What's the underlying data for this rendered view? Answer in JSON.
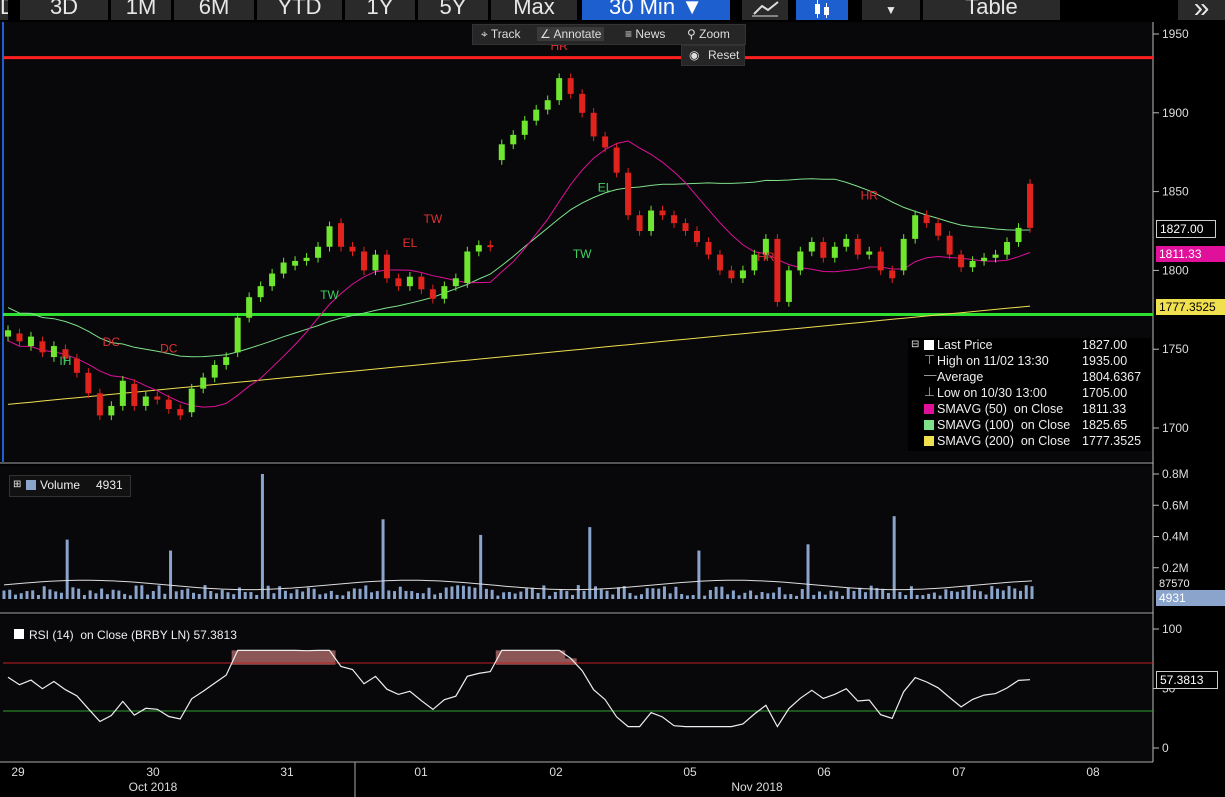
{
  "topbar": {
    "ranges": [
      "D",
      "3D",
      "1M",
      "6M",
      "YTD",
      "1Y",
      "5Y",
      "Max"
    ],
    "interval": "30 Min",
    "table_label": "Table",
    "more_glyph": "»"
  },
  "toolbar": {
    "track": "Track",
    "annotate": "Annotate",
    "news": "News",
    "zoom": "Zoom",
    "reset": "Reset"
  },
  "price_axis": {
    "ticks": [
      "1950",
      "1900",
      "1850",
      "1800",
      "1750",
      "1700"
    ]
  },
  "price_tags": {
    "last": "1827.00",
    "sma50": "1811.33",
    "sma200": "1777.3525"
  },
  "colors": {
    "up": "#6fe62f",
    "down": "#e0231c",
    "sma50": "#e0109a",
    "sma100": "#7fe08a",
    "sma200": "#f0e050",
    "hline_red": "#ff2020",
    "hline_green": "#30e030"
  },
  "annotations": [
    {
      "text": "HR",
      "color": "red"
    },
    {
      "text": "TW",
      "color": "red"
    },
    {
      "text": "EL",
      "color": "red"
    },
    {
      "text": "DC",
      "color": "red"
    },
    {
      "text": "DC",
      "color": "red"
    },
    {
      "text": "IH",
      "color": "green"
    },
    {
      "text": "TW",
      "color": "green"
    },
    {
      "text": "TW",
      "color": "green"
    },
    {
      "text": "EL",
      "color": "green"
    },
    {
      "text": "HR",
      "color": "red"
    },
    {
      "text": "HR",
      "color": "red"
    }
  ],
  "legend": {
    "rows": [
      {
        "name": "Last Price",
        "value": "1827.00"
      },
      {
        "name": "High on 11/02 13:30",
        "value": "1935.00"
      },
      {
        "name": "Average",
        "value": "1804.6367"
      },
      {
        "name": "Low on 10/30 13:00",
        "value": "1705.00"
      },
      {
        "name": "SMAVG (50)  on Close",
        "value": "1811.33"
      },
      {
        "name": "SMAVG (100)  on Close",
        "value": "1825.65"
      },
      {
        "name": "SMAVG (200)  on Close",
        "value": "1777.3525"
      }
    ]
  },
  "volume": {
    "label": "Volume",
    "value": "4931",
    "axis_ticks": [
      "0.8M",
      "0.6M",
      "0.4M",
      "0.2M"
    ],
    "avg_tag": "87570",
    "last_tag": "4931"
  },
  "rsi": {
    "label": "RSI (14)  on Close (BRBY LN) 57.3813",
    "axis_ticks": [
      "100",
      "50",
      "0"
    ],
    "tag": "57.3813"
  },
  "xaxis": {
    "days": [
      "29",
      "30",
      "31",
      "01",
      "02",
      "05",
      "06",
      "07",
      "08"
    ],
    "months": [
      "Oct 2018",
      "Nov 2018"
    ]
  },
  "chart_data": {
    "type": "candlestick",
    "ylim": [
      1690,
      1955
    ],
    "hlines": [
      1935,
      1772
    ],
    "candles": [
      [
        1758,
        1762
      ],
      [
        1760,
        1755
      ],
      [
        1752,
        1758
      ],
      [
        1755,
        1748
      ],
      [
        1745,
        1752
      ],
      [
        1750,
        1744
      ],
      [
        1744,
        1735
      ],
      [
        1735,
        1722
      ],
      [
        1722,
        1708
      ],
      [
        1708,
        1714
      ],
      [
        1714,
        1730
      ],
      [
        1728,
        1714
      ],
      [
        1714,
        1720
      ],
      [
        1720,
        1718
      ],
      [
        1718,
        1712
      ],
      [
        1712,
        1708
      ],
      [
        1710,
        1725
      ],
      [
        1725,
        1732
      ],
      [
        1732,
        1740
      ],
      [
        1740,
        1745
      ],
      [
        1748,
        1770
      ],
      [
        1770,
        1783
      ],
      [
        1783,
        1790
      ],
      [
        1790,
        1798
      ],
      [
        1798,
        1805
      ],
      [
        1803,
        1806
      ],
      [
        1806,
        1808
      ],
      [
        1808,
        1815
      ],
      [
        1815,
        1828
      ],
      [
        1830,
        1815
      ],
      [
        1815,
        1812
      ],
      [
        1812,
        1800
      ],
      [
        1800,
        1810
      ],
      [
        1810,
        1795
      ],
      [
        1795,
        1790
      ],
      [
        1790,
        1796
      ],
      [
        1796,
        1788
      ],
      [
        1788,
        1782
      ],
      [
        1782,
        1790
      ],
      [
        1790,
        1795
      ],
      [
        1792,
        1812
      ],
      [
        1812,
        1816
      ],
      [
        1816,
        1815
      ],
      [
        1870,
        1880
      ],
      [
        1880,
        1886
      ],
      [
        1886,
        1895
      ],
      [
        1895,
        1902
      ],
      [
        1902,
        1908
      ],
      [
        1908,
        1922
      ],
      [
        1922,
        1912
      ],
      [
        1912,
        1900
      ],
      [
        1900,
        1885
      ],
      [
        1885,
        1878
      ],
      [
        1878,
        1862
      ],
      [
        1862,
        1835
      ],
      [
        1835,
        1825
      ],
      [
        1825,
        1838
      ],
      [
        1838,
        1835
      ],
      [
        1835,
        1830
      ],
      [
        1830,
        1825
      ],
      [
        1825,
        1818
      ],
      [
        1818,
        1810
      ],
      [
        1810,
        1800
      ],
      [
        1800,
        1795
      ],
      [
        1795,
        1800
      ],
      [
        1800,
        1810
      ],
      [
        1810,
        1820
      ],
      [
        1820,
        1780
      ],
      [
        1780,
        1800
      ],
      [
        1800,
        1812
      ],
      [
        1812,
        1818
      ],
      [
        1818,
        1808
      ],
      [
        1808,
        1815
      ],
      [
        1815,
        1820
      ],
      [
        1820,
        1810
      ],
      [
        1810,
        1812
      ],
      [
        1812,
        1800
      ],
      [
        1800,
        1795
      ],
      [
        1800,
        1820
      ],
      [
        1820,
        1835
      ],
      [
        1835,
        1830
      ],
      [
        1830,
        1822
      ],
      [
        1822,
        1810
      ],
      [
        1810,
        1802
      ],
      [
        1802,
        1806
      ],
      [
        1806,
        1808
      ],
      [
        1808,
        1810
      ],
      [
        1810,
        1818
      ],
      [
        1818,
        1827
      ],
      [
        1855,
        1827
      ]
    ],
    "sma50_last": 1811.33,
    "sma100_last": 1825.65,
    "sma200_last": 1777.3525,
    "volume_max": 0.8,
    "rsi_last": 57.3813,
    "rsi_bands": [
      70,
      30
    ]
  }
}
